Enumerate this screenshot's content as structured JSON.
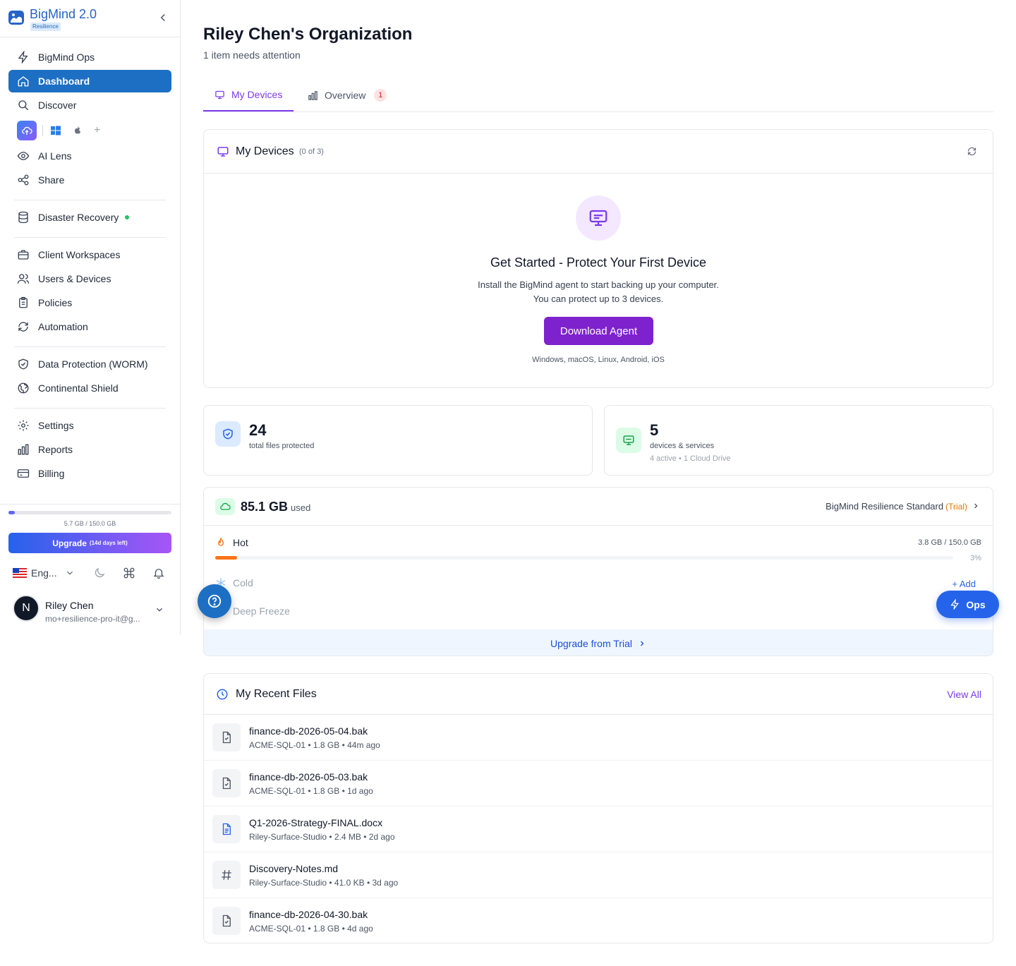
{
  "brand": {
    "name": "BigMind 2.0",
    "badge": "Resilience"
  },
  "sidebar": {
    "items": [
      {
        "label": "BigMind Ops"
      },
      {
        "label": "Dashboard"
      },
      {
        "label": "Discover"
      },
      {
        "label": "AI Lens"
      },
      {
        "label": "Share"
      },
      {
        "label": "Disaster Recovery"
      },
      {
        "label": "Client Workspaces"
      },
      {
        "label": "Users & Devices"
      },
      {
        "label": "Policies"
      },
      {
        "label": "Automation"
      },
      {
        "label": "Data Protection (WORM)"
      },
      {
        "label": "Continental Shield"
      },
      {
        "label": "Settings"
      },
      {
        "label": "Reports"
      },
      {
        "label": "Billing"
      }
    ],
    "os_plus": "+",
    "usage": {
      "text": "5.7 GB / 150.0 GB",
      "fraction": 0.038
    },
    "upgrade": {
      "label": "Upgrade",
      "note": "(14d days left)"
    },
    "language": "Eng...",
    "user": {
      "initial": "N",
      "name": "Riley Chen",
      "email": "mo+resilience-pro-it@g..."
    }
  },
  "page": {
    "title": "Riley Chen's Organization",
    "subtitle": "1 item needs attention"
  },
  "tabs": [
    {
      "label": "My Devices"
    },
    {
      "label": "Overview",
      "badge": "1"
    }
  ],
  "devices": {
    "title": "My Devices",
    "count": "(0 of 3)",
    "empty_title": "Get Started - Protect Your First Device",
    "empty_line1": "Install the BigMind agent to start backing up your computer.",
    "empty_line2": "You can protect up to 3 devices.",
    "button": "Download Agent",
    "platforms": "Windows, macOS, Linux, Android, iOS"
  },
  "stats": [
    {
      "value": "24",
      "label": "total files protected"
    },
    {
      "value": "5",
      "label": "devices & services",
      "sub": "4 active • 1 Cloud Drive"
    }
  ],
  "storage": {
    "used_value": "85.1 GB",
    "used_label": "used",
    "plan": "BigMind Resilience Standard",
    "plan_tag": "(Trial)",
    "hot": {
      "label": "Hot",
      "value": "3.8 GB / 150.0 GB",
      "pct": "3%",
      "fraction": 0.03
    },
    "cold": {
      "label": "Cold"
    },
    "deep": {
      "label": "Deep Freeze"
    },
    "add_label": "+ Add",
    "footer": "Upgrade from Trial"
  },
  "ops_label": "Ops",
  "recent": {
    "title": "My Recent Files",
    "view_all": "View All",
    "files": [
      {
        "name": "finance-db-2026-05-04.bak",
        "meta": "ACME-SQL-01 • 1.8 GB • 44m ago",
        "icon": "file-check-icon"
      },
      {
        "name": "finance-db-2026-05-03.bak",
        "meta": "ACME-SQL-01 • 1.8 GB • 1d ago",
        "icon": "file-check-icon"
      },
      {
        "name": "Q1-2026-Strategy-FINAL.docx",
        "meta": "Riley-Surface-Studio • 2.4 MB • 2d ago",
        "icon": "document-icon"
      },
      {
        "name": "Discovery-Notes.md",
        "meta": "Riley-Surface-Studio • 41.0 KB • 3d ago",
        "icon": "hash-icon"
      },
      {
        "name": "finance-db-2026-04-30.bak",
        "meta": "ACME-SQL-01 • 1.8 GB • 4d ago",
        "icon": "file-check-icon"
      }
    ]
  },
  "colors": {
    "primary": "#1d6fc4",
    "accent": "#7e22ce",
    "hot": "#f97316",
    "link": "#2563eb"
  }
}
